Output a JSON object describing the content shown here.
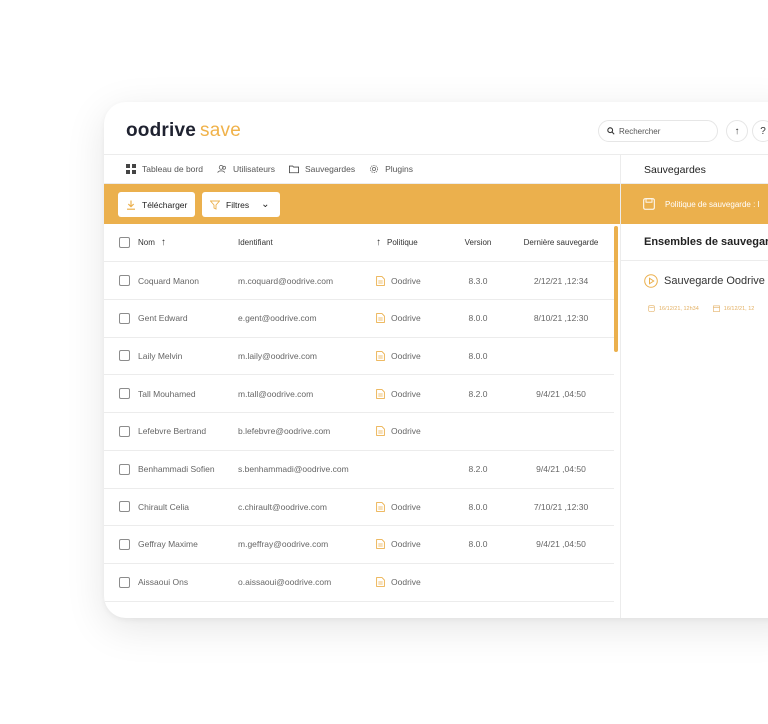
{
  "header": {
    "brand": "oodrive",
    "product": "save",
    "search_placeholder": "Rechercher",
    "upload_icon_glyph": "↑",
    "help_icon_glyph": "?"
  },
  "nav": {
    "items": [
      {
        "label": "Tableau de bord",
        "icon": "dashboard-icon"
      },
      {
        "label": "Utilisateurs",
        "icon": "users-icon"
      },
      {
        "label": "Sauvegardes",
        "icon": "folder-icon"
      },
      {
        "label": "Plugins",
        "icon": "gear-icon"
      }
    ]
  },
  "toolbar": {
    "download_label": "Télécharger",
    "filters_label": "Filtres",
    "filters_chevron": "⌄"
  },
  "right_panel": {
    "title": "Sauvegardes",
    "policy_label": "Politique de sauvegarde : I",
    "sets_title": "Ensembles de sauvegarde",
    "backup_name": "Sauvegarde Oodrive",
    "meta": [
      "16/12/21, 12h34",
      "16/12/21, 12"
    ]
  },
  "table": {
    "columns": {
      "name": "Nom",
      "name_sort": "↑",
      "identifier": "Identifiant",
      "policy_sort": "↑",
      "policy": "Politique",
      "version": "Version",
      "last_backup": "Dernière sauvegarde"
    },
    "rows": [
      {
        "name": "Coquard Manon",
        "id": "m.coquard@oodrive.com",
        "policy": "Oodrive",
        "version": "8.3.0",
        "date": "2/12/21 ,12:34"
      },
      {
        "name": "Gent Edward",
        "id": "e.gent@oodrive.com",
        "policy": "Oodrive",
        "version": "8.0.0",
        "date": "8/10/21 ,12:30"
      },
      {
        "name": "Laily Melvin",
        "id": "m.laily@oodrive.com",
        "policy": "Oodrive",
        "version": "8.0.0",
        "date": ""
      },
      {
        "name": "Tall Mouhamed",
        "id": "m.tall@oodrive.com",
        "policy": "Oodrive",
        "version": "8.2.0",
        "date": "9/4/21 ,04:50"
      },
      {
        "name": "Lefebvre Bertrand",
        "id": "b.lefebvre@oodrive.com",
        "policy": "Oodrive",
        "version": "",
        "date": ""
      },
      {
        "name": "Benhammadi Sofien",
        "id": "s.benhammadi@oodrive.com",
        "policy": "",
        "version": "8.2.0",
        "date": "9/4/21 ,04:50"
      },
      {
        "name": "Chirault Celia",
        "id": "c.chirault@oodrive.com",
        "policy": "Oodrive",
        "version": "8.0.0",
        "date": "7/10/21 ,12:30"
      },
      {
        "name": "Geffray Maxime",
        "id": "m.geffray@oodrive.com",
        "policy": "Oodrive",
        "version": "8.0.0",
        "date": "9/4/21 ,04:50"
      },
      {
        "name": "Aissaoui Ons",
        "id": "o.aissaoui@oodrive.com",
        "policy": "Oodrive",
        "version": "",
        "date": ""
      }
    ]
  },
  "colors": {
    "accent": "#ebb04d",
    "brand_dark": "#1f2230"
  }
}
